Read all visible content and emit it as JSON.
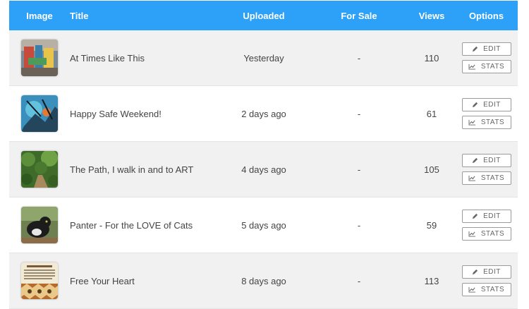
{
  "header": {
    "image": "Image",
    "title": "Title",
    "uploaded": "Uploaded",
    "for_sale": "For Sale",
    "views": "Views",
    "options": "Options"
  },
  "actions": {
    "edit": "EDIT",
    "stats": "STATS"
  },
  "rows": [
    {
      "title": "At Times Like This",
      "uploaded": "Yesterday",
      "for_sale": "-",
      "views": "110",
      "thumb": "graffiti-wall"
    },
    {
      "title": "Happy Safe Weekend!",
      "uploaded": "2 days ago",
      "for_sale": "-",
      "views": "61",
      "thumb": "blue-abstract"
    },
    {
      "title": "The Path, I walk in and to ART",
      "uploaded": "4 days ago",
      "for_sale": "-",
      "views": "105",
      "thumb": "forest-path"
    },
    {
      "title": "Panter - For the LOVE of Cats",
      "uploaded": "5 days ago",
      "for_sale": "-",
      "views": "59",
      "thumb": "black-cat"
    },
    {
      "title": "Free Your Heart",
      "uploaded": "8 days ago",
      "for_sale": "-",
      "views": "113",
      "thumb": "text-card"
    }
  ],
  "colors": {
    "header_bg": "#2da0f7",
    "row_alt_bg": "#f1f1f1"
  }
}
